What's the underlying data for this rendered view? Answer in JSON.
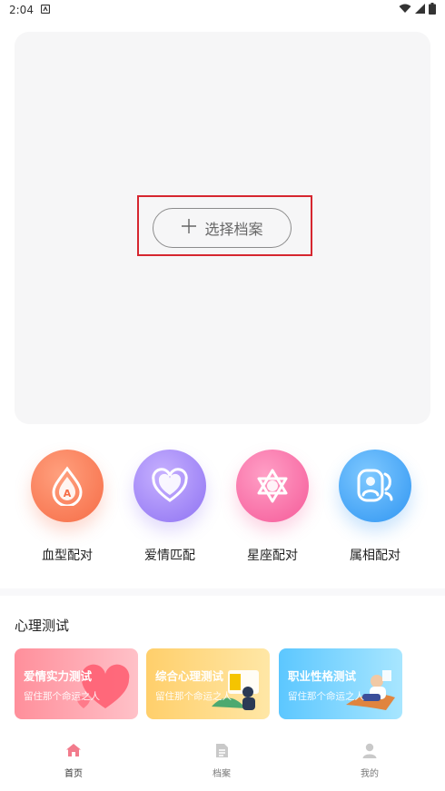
{
  "status_bar": {
    "time": "2:04"
  },
  "profile": {
    "select_label": "选择档案"
  },
  "features": [
    {
      "label": "血型配对",
      "icon": "blood-drop-icon"
    },
    {
      "label": "爱情匹配",
      "icon": "heart-icon"
    },
    {
      "label": "星座配对",
      "icon": "star-of-david-icon"
    },
    {
      "label": "属相配对",
      "icon": "users-icon"
    }
  ],
  "psych": {
    "title": "心理测试",
    "cards": [
      {
        "title": "爱情实力测试",
        "subtitle": "留住那个命运之人"
      },
      {
        "title": "综合心理测试",
        "subtitle": "留住那个命运之人"
      },
      {
        "title": "职业性格测试",
        "subtitle": "留住那个命运之人"
      }
    ]
  },
  "tabbar": {
    "items": [
      {
        "label": "首页",
        "active": true
      },
      {
        "label": "档案",
        "active": false
      },
      {
        "label": "我的",
        "active": false
      }
    ]
  },
  "colors": {
    "highlight": "#d6262f",
    "blood": "#f66c46",
    "love": "#8e72f2",
    "star": "#f55a98",
    "zodiac": "#2f95f2",
    "home_active": "#f27b8c"
  }
}
